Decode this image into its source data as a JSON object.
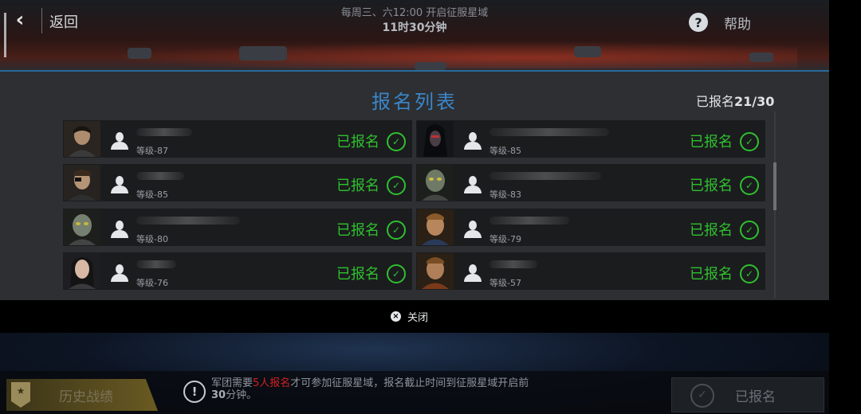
{
  "header": {
    "back_label": "返回",
    "schedule": "每周三、六12:00 开启征服星域",
    "countdown": "11时30分钟",
    "help_label": "帮助"
  },
  "modal": {
    "title": "报名列表",
    "count_prefix": "已报名",
    "count_value": "21/30",
    "close_label": "关闭"
  },
  "entries": [
    {
      "level": "等级-87",
      "status": "已报名"
    },
    {
      "level": "等级-85",
      "status": "已报名"
    },
    {
      "level": "等级-85",
      "status": "已报名"
    },
    {
      "level": "等级-83",
      "status": "已报名"
    },
    {
      "level": "等级-80",
      "status": "已报名"
    },
    {
      "level": "等级-79",
      "status": "已报名"
    },
    {
      "level": "等级-76",
      "status": "已报名"
    },
    {
      "level": "等级-57",
      "status": "已报名"
    }
  ],
  "footer": {
    "history_label": "历史战绩",
    "notice_before": "军团需要",
    "notice_red": "5人报名",
    "notice_after": "才可参加征服星域，报名截止时间到征服星域开启前",
    "notice_bold": "30",
    "notice_end": "分钟。",
    "registered_label": "已报名"
  },
  "colors": {
    "status_green": "#2fc02f",
    "title_blue": "#3b86c9",
    "warning_red": "#d02222"
  }
}
